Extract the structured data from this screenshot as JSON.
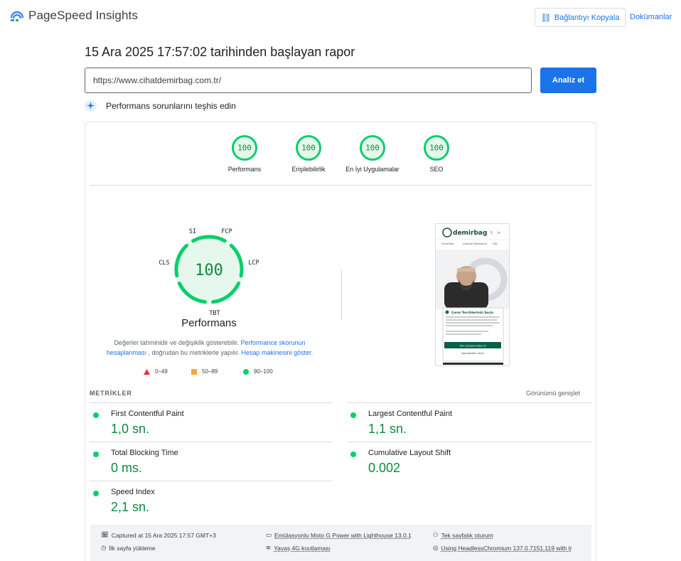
{
  "header": {
    "brand": "PageSpeed Insights",
    "copy_link": "Bağlantıyı Kopyala",
    "docs": "Dokümanlar"
  },
  "report": {
    "title": "15 Ara 2025 17:57:02 tarihinden başlayan rapor",
    "url": "https://www.cihatdemirbag.com.tr/",
    "analyze": "Analiz et",
    "diagnose": "Performans sorunlarını teşhis edin"
  },
  "categories": [
    {
      "score": "100",
      "label": "Performans"
    },
    {
      "score": "100",
      "label": "Erişilebilirlik"
    },
    {
      "score": "100",
      "label": "En İyi Uygulamalar"
    },
    {
      "score": "100",
      "label": "SEO"
    }
  ],
  "gauge": {
    "score": "100",
    "label": "Performans",
    "segments": [
      "SI",
      "FCP",
      "LCP",
      "TBT",
      "CLS"
    ]
  },
  "description": {
    "part1": "Değerler tahminidir ve değişiklik gösterebilir. ",
    "link1": "Performance skorunun hesaplanması",
    "part2": " , doğrudan bu metriklerle yapılır. ",
    "link2": "Hesap makinesini göster."
  },
  "legend": [
    {
      "range": "0–49",
      "color": "#e8313b"
    },
    {
      "range": "50–89",
      "color": "#f4a93a"
    },
    {
      "range": "90–100",
      "color": "#0cce6b"
    }
  ],
  "screenshot": {
    "logo": "demirbag",
    "nav": [
      "Cihat Başı",
      "Çözüme Mahareme",
      "Fatt"
    ],
    "dialog_title": "Çerez Tercihlerinizi Seçin",
    "accept": "Tüm çerezleri kabul et",
    "settings": "Ayarlamaları Seçin"
  },
  "metrics": {
    "title": "METRİKLER",
    "expand": "Görünümü genişlet",
    "items": [
      {
        "name": "First Contentful Paint",
        "value": "1,0 sn."
      },
      {
        "name": "Largest Contentful Paint",
        "value": "1,1 sn."
      },
      {
        "name": "Total Blocking Time",
        "value": "0 ms."
      },
      {
        "name": "Cumulative Layout Shift",
        "value": "0.002"
      },
      {
        "name": "Speed Index",
        "value": "2,1 sn."
      }
    ]
  },
  "footer": {
    "captured": "Captured at 15 Ara 2025 17:57 GMT+3",
    "emulation": "Emülasyonlu Moto G Power with Lighthouse 13.0.1",
    "session": "Tek sayfalık oturum",
    "initial_load": "İlk sayfa yükleme",
    "throttling": "Yavaş 4G kısıtlaması",
    "browser": "Using HeadlessChromium 137.0.7151.119 with lr"
  },
  "colors": {
    "accent": "#1a73e8",
    "pass": "#0cce6b",
    "pass_text": "#0d8a3e",
    "pass_bg": "#e6f8ee"
  }
}
